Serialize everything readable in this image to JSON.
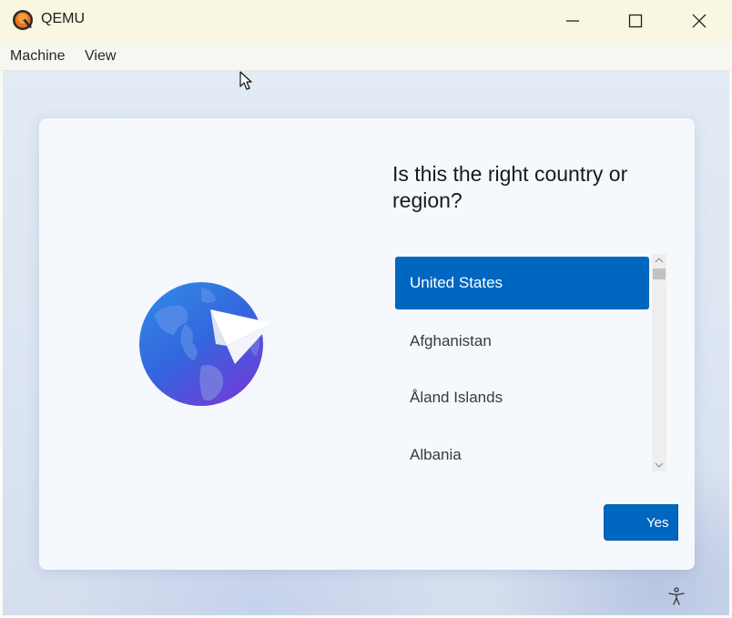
{
  "window": {
    "title": "QEMU",
    "icon": "qemu-logo-icon",
    "controls": [
      "minimize-icon",
      "maximize-icon",
      "close-icon"
    ]
  },
  "menu": {
    "machine": "Machine",
    "view": "View"
  },
  "oobe": {
    "question": "Is this the right country or region?",
    "hero_icon": "globe-paper-plane-icon",
    "countries": [
      "United States",
      "Afghanistan",
      "Åland Islands",
      "Albania"
    ],
    "selected": "United States",
    "yes_button": "Yes",
    "accessibility_icon": "accessibility-icon"
  },
  "colors": {
    "accent": "#0067c0",
    "titlebar": "#f9f7e1"
  }
}
